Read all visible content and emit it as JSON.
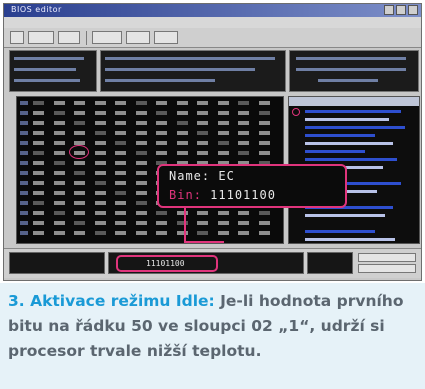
{
  "window": {
    "title": "BIOS editor"
  },
  "callout": {
    "name_key": "Name",
    "name_value": "EC",
    "bin_key": "Bin",
    "bin_value": "11101100"
  },
  "mini_field": {
    "value": "11101100"
  },
  "caption": {
    "number": "3.",
    "heading": "Aktivace režimu Idle:",
    "body": "Je-li hodnota prvního bitu na řádku 50 ve sloupci 02 „1“, udrží si procesor trvale nižší teplotu."
  },
  "colors": {
    "accent_magenta": "#e0347c",
    "caption_blue": "#1a9ad6",
    "caption_text": "#5b6670",
    "caption_bg": "#e6f2f8"
  }
}
